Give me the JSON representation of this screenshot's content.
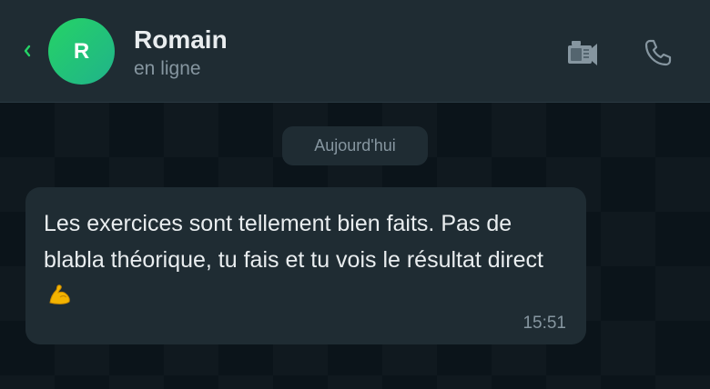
{
  "header": {
    "back_icon": "chevron-left-icon",
    "avatar_initial": "R",
    "contact_name": "Romain",
    "contact_status": "en ligne",
    "video_icon": "video-call-icon",
    "phone_icon": "phone-icon"
  },
  "chat": {
    "date_separator": "Aujourd'hui",
    "messages": [
      {
        "text": "Les exercices sont tellement bien faits. Pas de blabla théorique, tu fais et tu vois le résultat direct",
        "emoji": "flexed-biceps-icon",
        "time": "15:51"
      }
    ]
  },
  "colors": {
    "accent": "#25d366",
    "header_bg": "#1f2c33",
    "chat_bg": "#0b141a",
    "bubble_bg": "#1f2c33"
  }
}
